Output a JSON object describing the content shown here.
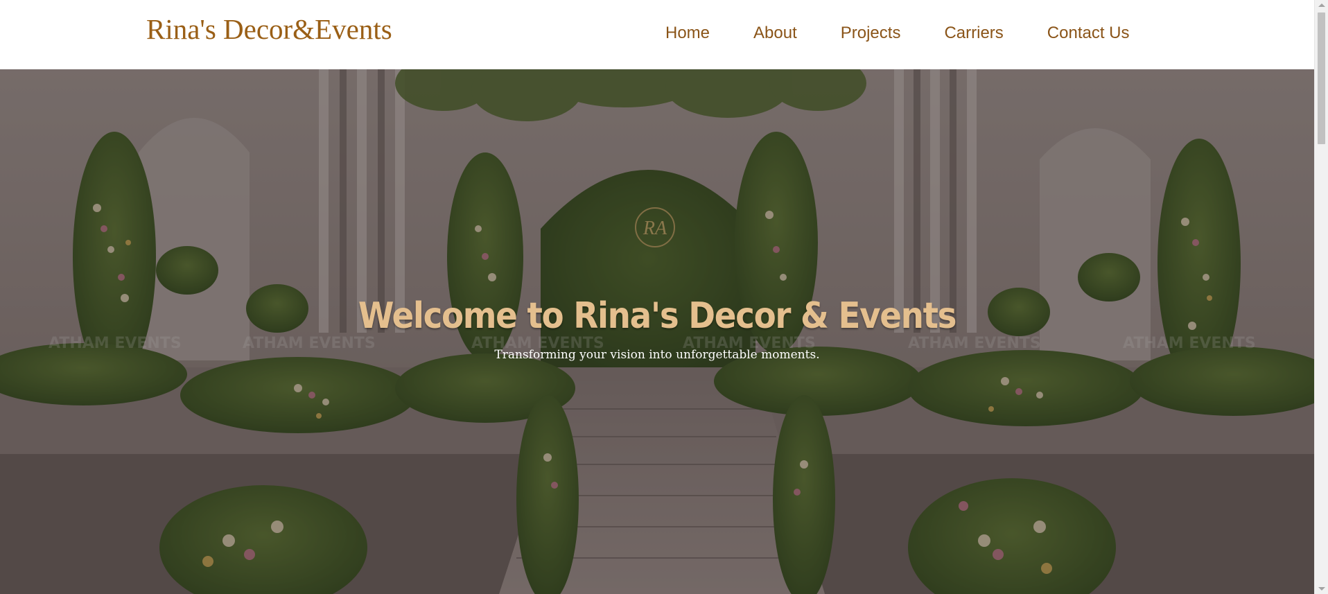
{
  "header": {
    "logo_text": "Rina's Decor&Events",
    "nav": [
      {
        "label": "Home"
      },
      {
        "label": "About"
      },
      {
        "label": "Projects"
      },
      {
        "label": "Carriers"
      },
      {
        "label": "Contact Us"
      }
    ]
  },
  "hero": {
    "title": "Welcome to Rina's Decor & Events",
    "subtitle": "Transforming your vision into unforgettable moments.",
    "arch_monogram": "RA",
    "watermark": "ATHAM EVENTS"
  },
  "colors": {
    "brand": "#9a5f16",
    "nav_text": "#8a5418",
    "hero_title": "#e4bf8e",
    "hero_subtitle": "#ffffff"
  },
  "icons": {
    "scroll_up": "triangle-up",
    "scroll_down": "triangle-down"
  }
}
